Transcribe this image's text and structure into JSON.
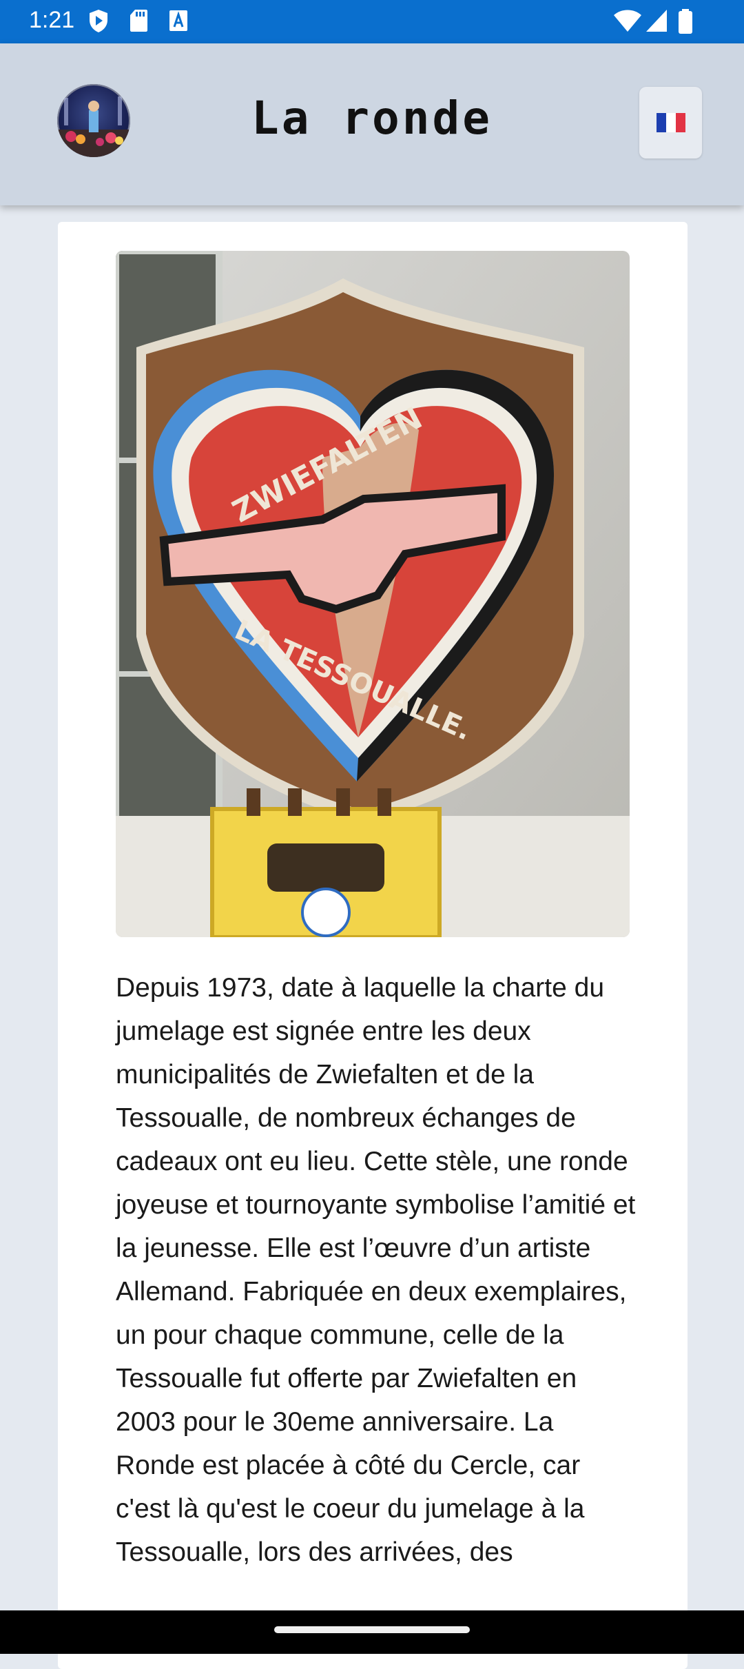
{
  "status_bar": {
    "time": "1:21",
    "left_icons": [
      "play-protect-icon",
      "sd-card-icon",
      "keyboard-a-icon"
    ],
    "right_icons": [
      "wifi-icon",
      "signal-icon",
      "battery-icon"
    ]
  },
  "app_bar": {
    "title": "La ronde",
    "avatar_icon": "app-logo-avatar",
    "language_flag_icon": "french-flag-icon"
  },
  "content": {
    "image_description_icon": "shield-heart-photo",
    "photo_text": {
      "line1": "ZWIEFALTEN",
      "line2": "LA TESSOUALLE."
    },
    "description": "Depuis 1973, date à laquelle la charte du jumelage est signée entre les deux municipalités de Zwiefalten et de la Tessoualle, de nombreux échanges de cadeaux ont eu lieu. Cette stèle, une ronde joyeuse et tournoyante symbolise l’amitié et la jeunesse. Elle est l’œuvre d’un artiste Allemand. Fabriquée en deux exemplaires, un pour chaque commune, celle de la Tessoualle fut offerte par Zwiefalten en 2003 pour le 30eme anniversaire. La Ronde est placée à côté du Cercle, car c'est là qu'est le coeur du jumelage à la Tessoualle, lors des arrivées, des"
  },
  "colors": {
    "status_bar": "#0a6fce",
    "app_bar": "#cdd6e2",
    "background": "#e4e9f0",
    "card": "#ffffff"
  }
}
